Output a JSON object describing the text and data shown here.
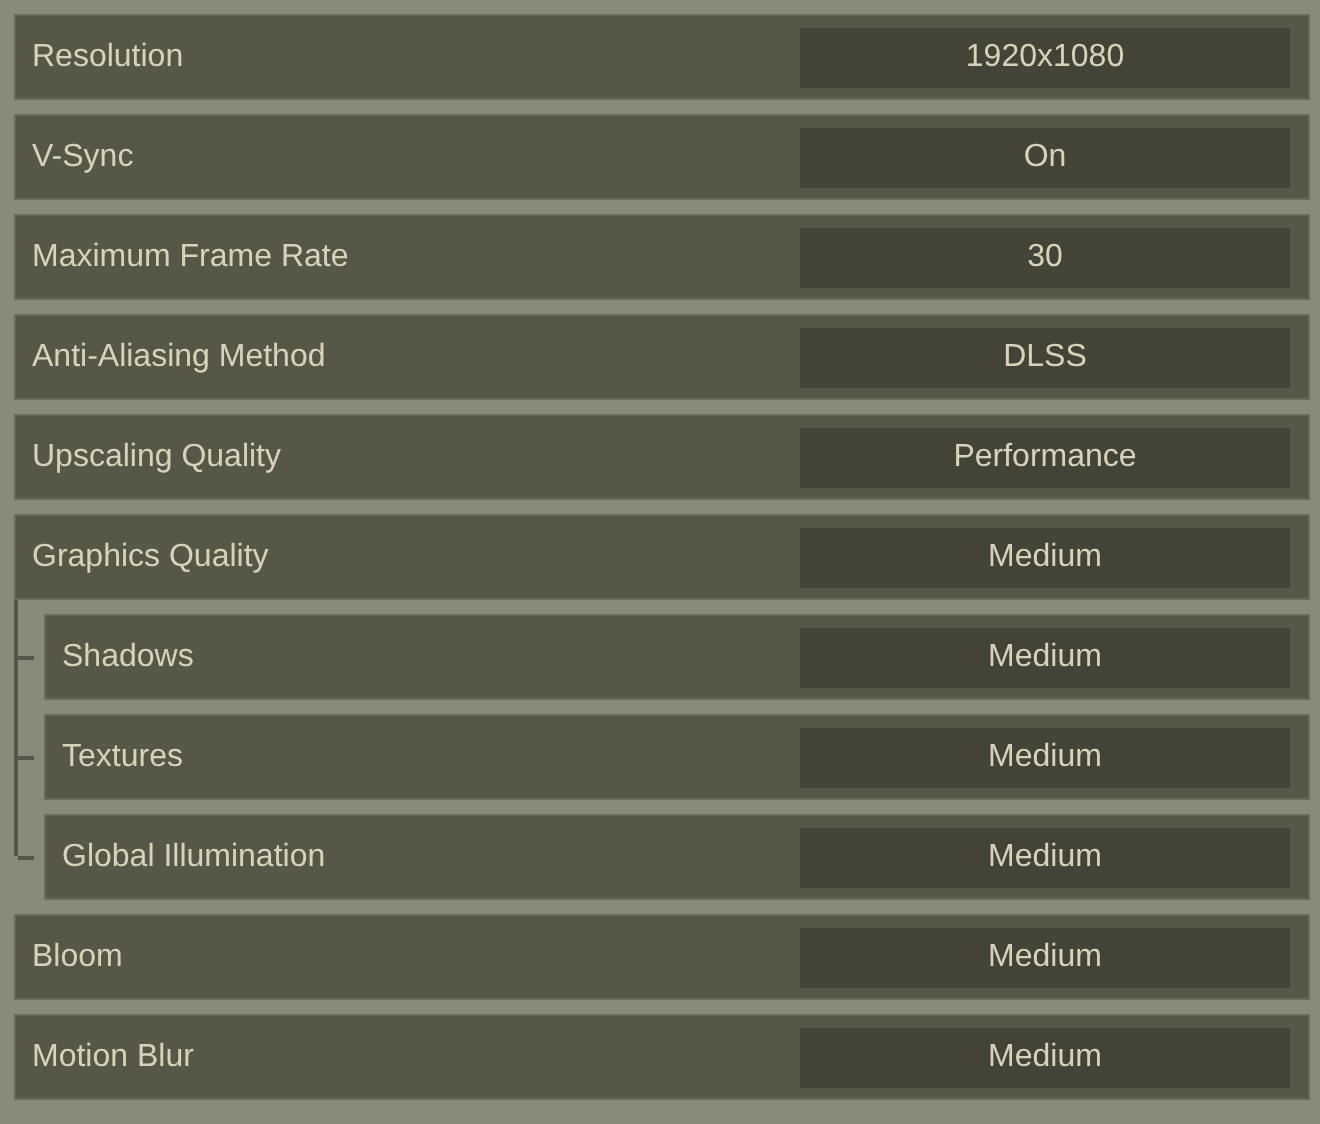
{
  "settings": [
    {
      "label": "Resolution",
      "value": "1920x1080"
    },
    {
      "label": "V-Sync",
      "value": "On"
    },
    {
      "label": "Maximum Frame Rate",
      "value": "30"
    },
    {
      "label": "Anti-Aliasing Method",
      "value": "DLSS"
    },
    {
      "label": "Upscaling Quality",
      "value": "Performance"
    },
    {
      "label": "Graphics Quality",
      "value": "Medium",
      "children": [
        {
          "label": "Shadows",
          "value": "Medium"
        },
        {
          "label": "Textures",
          "value": "Medium"
        },
        {
          "label": "Global Illumination",
          "value": "Medium"
        }
      ]
    },
    {
      "label": "Bloom",
      "value": "Medium"
    },
    {
      "label": "Motion Blur",
      "value": "Medium"
    }
  ]
}
